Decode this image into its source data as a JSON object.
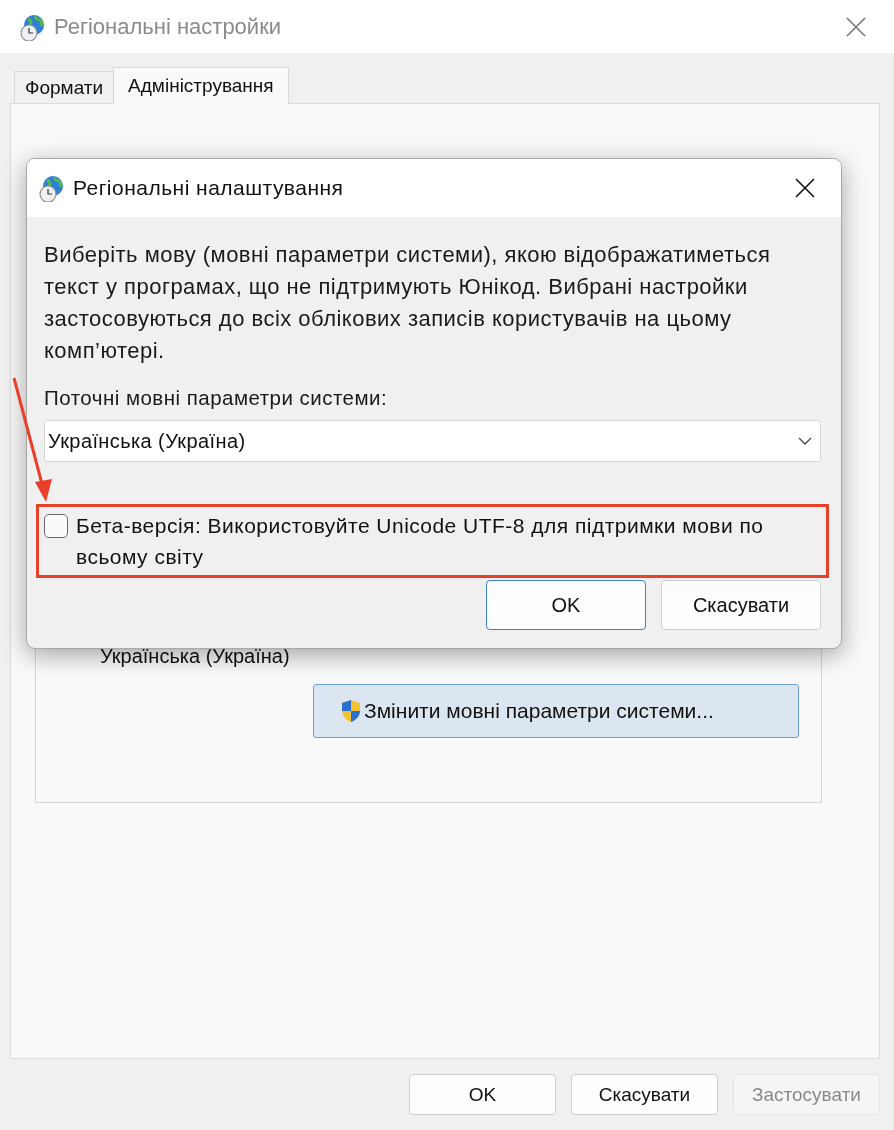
{
  "window": {
    "title": "Регіональні настройки",
    "active": false
  },
  "tabs": [
    {
      "label": "Формати",
      "selected": false
    },
    {
      "label": "Адміністрування",
      "selected": true
    }
  ],
  "panel": {
    "group": {
      "value": "Українська (Україна)",
      "button": "Змінити мовні параметри системи..."
    }
  },
  "buttons": [
    {
      "label": "OK",
      "disabled": false
    },
    {
      "label": "Скасувати",
      "disabled": false
    },
    {
      "label": "Застосувати",
      "disabled": true
    }
  ],
  "dialog": {
    "title": "Регіональні налаштування",
    "description": "Виберіть мову (мовні параметри системи), якою відображатиметься текст у програмах, що не підтримують Юнікод. Вибрані настройки застосовуються до всіх облікових записів користувачів на цьому комп’ютері.",
    "field_label": "Поточні мовні параметри системи:",
    "dropdown": {
      "value": "Українська (Україна)"
    },
    "checkbox": {
      "label": "Бета-версія: Використовуйте Unicode UTF-8 для підтримки мови по всьому світу",
      "checked": false
    },
    "buttons": [
      {
        "label": "OK",
        "default": true
      },
      {
        "label": "Скасувати",
        "default": false
      }
    ]
  }
}
